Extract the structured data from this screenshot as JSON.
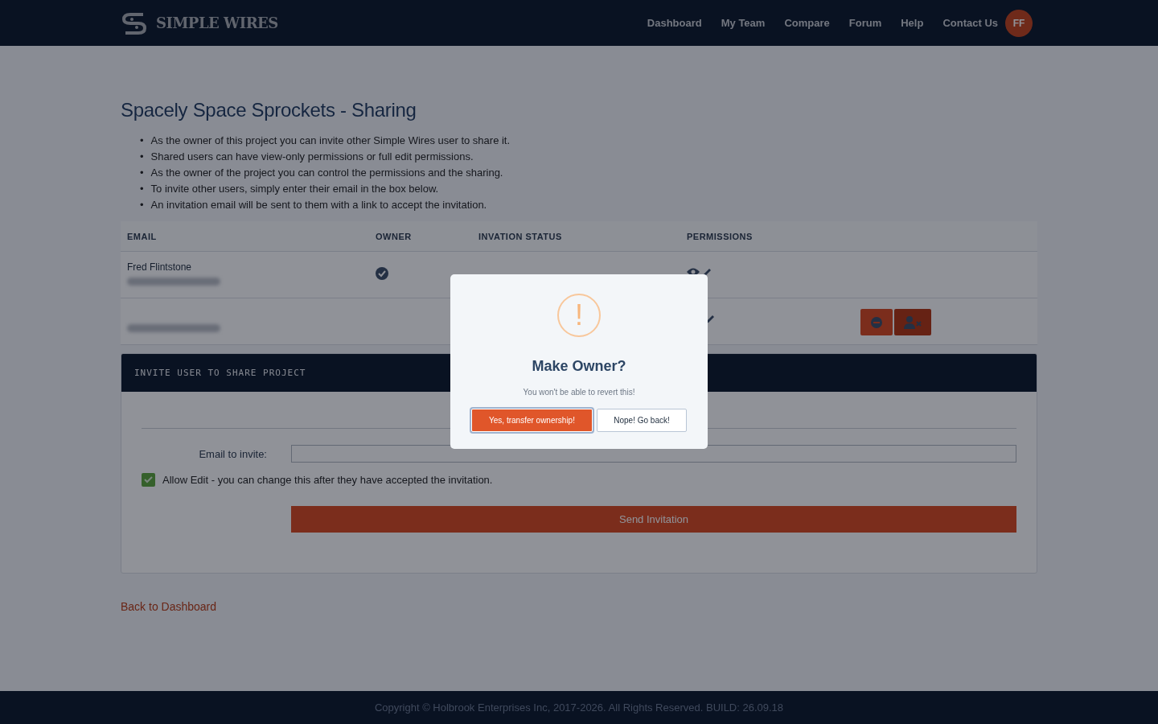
{
  "nav": {
    "brand": "SIMPLE WIRES",
    "links": [
      "Dashboard",
      "My Team",
      "Compare",
      "Forum",
      "Help",
      "Contact Us"
    ],
    "avatar": "FF"
  },
  "page": {
    "title": "Spacely Space Sprockets - Sharing",
    "bullet": "•",
    "notes": [
      "As the owner of this project you can invite other Simple Wires user to share it.",
      "Shared users can have view-only permissions or full edit permissions.",
      "As the owner of the project you can control the permissions and the sharing.",
      "To invite other users, simply enter their email in the box below.",
      "An invitation email will be sent to them with a link to accept the invitation."
    ]
  },
  "table": {
    "columns": [
      "EMAIL",
      "OWNER",
      "INVATION STATUS",
      "PERMISSIONS"
    ],
    "rows": [
      {
        "name": "Fred Flintstone",
        "owner": true,
        "view": true,
        "edit": true,
        "actions": []
      },
      {
        "owner": false,
        "edit": true,
        "actions": [
          {
            "kind": "remove"
          },
          {
            "kind": "remove-user"
          }
        ]
      }
    ]
  },
  "invite": {
    "title": "INVITE USER TO SHARE PROJECT",
    "email_label": "Email to invite:",
    "allow_edit": {
      "label": "Allow Edit - you can change this after they have accepted the invitation.",
      "checked": true
    },
    "send": "Send Invitation"
  },
  "back_link": "Back to Dashboard",
  "footer": "Copyright © Holbrook Enterprises Inc, 2017-2026. All Rights Reserved. BUILD: 26.09.18",
  "dialog": {
    "icon": "!",
    "title": "Make Owner?",
    "text": "You won't be able to revert this!",
    "confirm": "Yes, transfer ownership!",
    "cancel": "Nope! Go back!"
  }
}
